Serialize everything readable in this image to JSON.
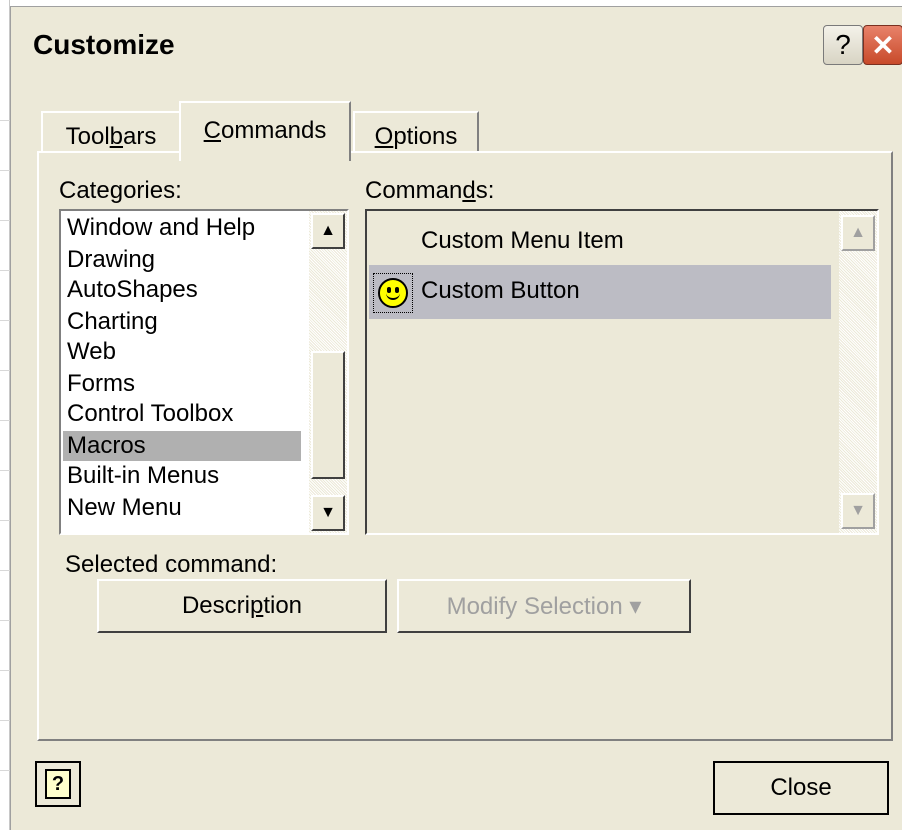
{
  "dialog": {
    "title": "Customize",
    "help_glyph": "?",
    "close_glyph": "✕"
  },
  "tabs": [
    {
      "label_pre": "Tool",
      "label_u": "b",
      "label_post": "ars"
    },
    {
      "label_pre": "",
      "label_u": "C",
      "label_post": "ommands"
    },
    {
      "label_pre": "",
      "label_u": "O",
      "label_post": "ptions"
    }
  ],
  "categories": {
    "label_pre": "Cate",
    "label_u": "g",
    "label_post": "ories:",
    "items": [
      "Window and Help",
      "Drawing",
      "AutoShapes",
      "Charting",
      "Web",
      "Forms",
      "Control Toolbox",
      "Macros",
      "Built-in Menus",
      "New Menu"
    ],
    "selected": "Macros"
  },
  "commands": {
    "label_pre": "Comman",
    "label_u": "d",
    "label_post": "s:",
    "items": [
      {
        "label": "Custom Menu Item",
        "icon": ""
      },
      {
        "label": "Custom Button",
        "icon": "smiley-icon"
      }
    ],
    "selected": "Custom Button"
  },
  "selected_command": {
    "label": "Selected command:",
    "description_pre": "Descri",
    "description_u": "p",
    "description_post": "tion",
    "modify_label": "Modify Selection ▾"
  },
  "footer": {
    "close_label": "Close",
    "help_glyph": "?"
  },
  "scroll": {
    "up_arrow": "▲",
    "down_arrow": "▼"
  },
  "colors": {
    "dialog_bg": "#ece9d8",
    "selection": "#b0b0b0",
    "close_button": "#c84a2a"
  }
}
